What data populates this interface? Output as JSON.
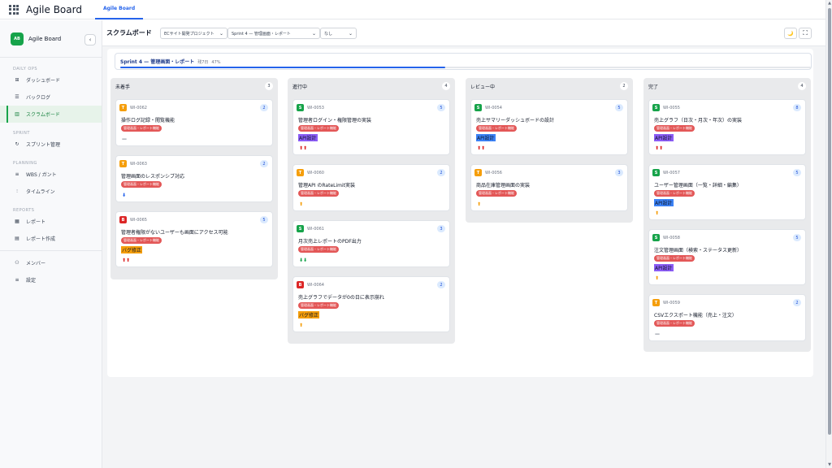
{
  "app": {
    "title": "Agile Board",
    "tab": "Agile Board"
  },
  "sidebar": {
    "brand_logo": "AB",
    "brand_name": "Agile Board",
    "collapse_icon": "‹",
    "sections": [
      {
        "label": "DAILY OPS",
        "items": [
          {
            "label": "ダッシュボード",
            "icon": "grid-icon"
          },
          {
            "label": "バックログ",
            "icon": "list-icon"
          },
          {
            "label": "スクラムボード",
            "icon": "board-icon",
            "active": true
          }
        ]
      },
      {
        "label": "SPRINT",
        "items": [
          {
            "label": "スプリント管理",
            "icon": "refresh-icon"
          }
        ]
      },
      {
        "label": "PLANNING",
        "items": [
          {
            "label": "WBS / ガント",
            "icon": "gantt-icon"
          },
          {
            "label": "タイムライン",
            "icon": "timeline-icon"
          }
        ]
      },
      {
        "label": "REPORTS",
        "items": [
          {
            "label": "レポート",
            "icon": "chart-icon"
          },
          {
            "label": "レポート作成",
            "icon": "doc-icon"
          }
        ]
      }
    ],
    "bottom_items": [
      {
        "label": "メンバー",
        "icon": "users-icon"
      },
      {
        "label": "設定",
        "icon": "settings-icon"
      }
    ]
  },
  "toolbar": {
    "title": "スクラムボード",
    "project_select": "ECサイト開発プロジェクト",
    "sprint_select": "Sprint 4 — 管理画面・レポート",
    "filter_select": "なし",
    "theme_icon": "🌙",
    "fullscreen_icon": "⛶"
  },
  "sprint": {
    "name": "Sprint 4 — 管理画面・レポート",
    "remaining": "残7日",
    "percent": "47%",
    "progress": 0.47
  },
  "colors": {
    "task": "#f59e0b",
    "story": "#16a34a",
    "bug": "#dc2626",
    "epic": "#e35757",
    "accent": "#2563eb"
  },
  "columns": [
    {
      "title": "未着手",
      "count": "3",
      "cards": [
        {
          "type": "T",
          "id": "WI-0062",
          "points": "2",
          "title": "操作ログ記録・閲覧機能",
          "epic": "管理画面・レポート機能",
          "prio": "—",
          "prio_color": "#6b7280"
        },
        {
          "type": "T",
          "id": "WI-0063",
          "points": "2",
          "title": "管理画面のレスポンシブ対応",
          "epic": "管理画面・レポート機能",
          "prio": "⬇",
          "prio_color": "#2563eb"
        },
        {
          "type": "B",
          "id": "WI-0065",
          "points": "5",
          "title": "管理者権限がないユーザーも画面にアクセス可能",
          "epic": "管理画面・レポート機能",
          "label": "バグ修正",
          "label_bg": "#f59e0b",
          "prio": "⬆⬆",
          "prio_color": "#dc2626"
        }
      ]
    },
    {
      "title": "進行中",
      "count": "4",
      "cards": [
        {
          "type": "S",
          "id": "WI-0053",
          "points": "5",
          "title": "管理者ログイン・権限管理の実装",
          "epic": "管理画面・レポート機能",
          "label": "API設計",
          "label_bg": "#8b5cf6",
          "prio": "⬆⬆",
          "prio_color": "#dc2626"
        },
        {
          "type": "T",
          "id": "WI-0060",
          "points": "2",
          "title": "管理API のRateLimit実装",
          "epic": "管理画面・レポート機能",
          "prio": "⬆",
          "prio_color": "#f59e0b"
        },
        {
          "type": "S",
          "id": "WI-0061",
          "points": "3",
          "title": "月次売上レポートのPDF出力",
          "epic": "管理画面・レポート機能",
          "prio": "⬇⬇",
          "prio_color": "#16a34a"
        },
        {
          "type": "B",
          "id": "WI-0064",
          "points": "2",
          "title": "売上グラフでデータが0の日に表示崩れ",
          "epic": "管理画面・レポート機能",
          "label": "バグ修正",
          "label_bg": "#f59e0b",
          "prio": "⬆",
          "prio_color": "#f59e0b"
        }
      ]
    },
    {
      "title": "レビュー中",
      "count": "2",
      "cards": [
        {
          "type": "S",
          "id": "WI-0054",
          "points": "5",
          "title": "売上サマリーダッシュボードの設計",
          "epic": "管理画面・レポート機能",
          "label": "API設計",
          "label_bg": "#3b82f6",
          "prio": "⬆⬆",
          "prio_color": "#dc2626"
        },
        {
          "type": "T",
          "id": "WI-0056",
          "points": "3",
          "title": "商品在庫管理画面の実装",
          "epic": "管理画面・レポート機能",
          "prio": "⬆",
          "prio_color": "#f59e0b"
        }
      ]
    },
    {
      "title": "完了",
      "count": "4",
      "cards": [
        {
          "type": "S",
          "id": "WI-0055",
          "points": "8",
          "title": "売上グラフ（日次・月次・年次）の実装",
          "epic": "管理画面・レポート機能",
          "label": "API設計",
          "label_bg": "#8b5cf6",
          "prio": "⬆⬆",
          "prio_color": "#dc2626"
        },
        {
          "type": "S",
          "id": "WI-0057",
          "points": "5",
          "title": "ユーザー管理画面（一覧・詳細・編集）",
          "epic": "管理画面・レポート機能",
          "label": "API設計",
          "label_bg": "#3b82f6",
          "prio": "⬆",
          "prio_color": "#f59e0b"
        },
        {
          "type": "S",
          "id": "WI-0058",
          "points": "5",
          "title": "注文管理画面（検索・ステータス更新）",
          "epic": "管理画面・レポート機能",
          "label": "API設計",
          "label_bg": "#8b5cf6",
          "prio": "⬆",
          "prio_color": "#f59e0b"
        },
        {
          "type": "T",
          "id": "WI-0059",
          "points": "2",
          "title": "CSVエクスポート機能（売上・注文）",
          "epic": "管理画面・レポート機能",
          "prio": "—",
          "prio_color": "#6b7280"
        }
      ]
    }
  ]
}
